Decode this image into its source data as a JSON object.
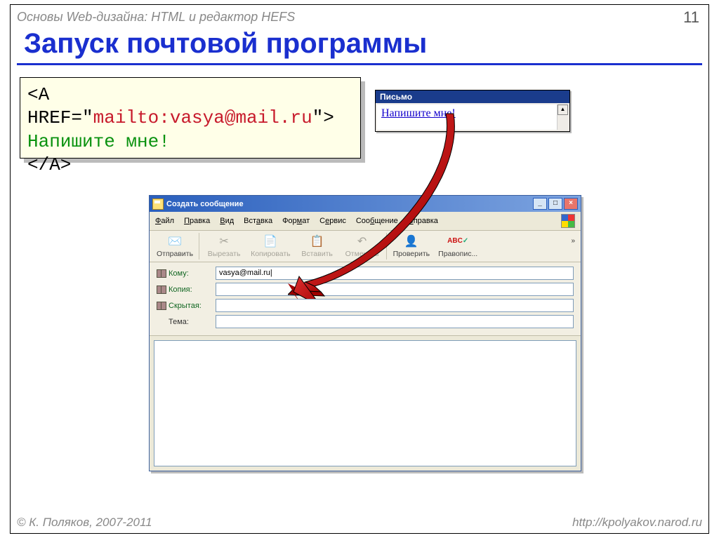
{
  "header": "Основы Web-дизайна: HTML и редактор HEFS",
  "page_number": "11",
  "title": "Запуск почтовой программы",
  "code": {
    "tag_open_pre": "<A HREF=\"",
    "href_value": "mailto:vasya@mail.ru",
    "tag_open_post": "\">",
    "link_text": "Напишите мне!",
    "tag_close": "</A>"
  },
  "preview": {
    "window_title": "Письмо",
    "link_text": "Напишите мне!"
  },
  "mail": {
    "window_title": "Создать сообщение",
    "menu": {
      "file": "Файл",
      "edit": "Правка",
      "view": "Вид",
      "insert": "Вставка",
      "format": "Формат",
      "tools": "Сервис",
      "message": "Сообщение",
      "help": "Справка"
    },
    "toolbar": {
      "send": "Отправить",
      "cut": "Вырезать",
      "copy": "Копировать",
      "paste": "Вставить",
      "undo": "Отменить",
      "check": "Проверить",
      "spelling": "Правопис..."
    },
    "labels": {
      "to": "Кому:",
      "cc": "Копия:",
      "bcc": "Скрытая:",
      "subject": "Тема:"
    },
    "fields": {
      "to_value": "vasya@mail.ru|"
    }
  },
  "footer": {
    "left": "© К. Поляков, 2007-2011",
    "right": "http://kpolyakov.narod.ru"
  }
}
